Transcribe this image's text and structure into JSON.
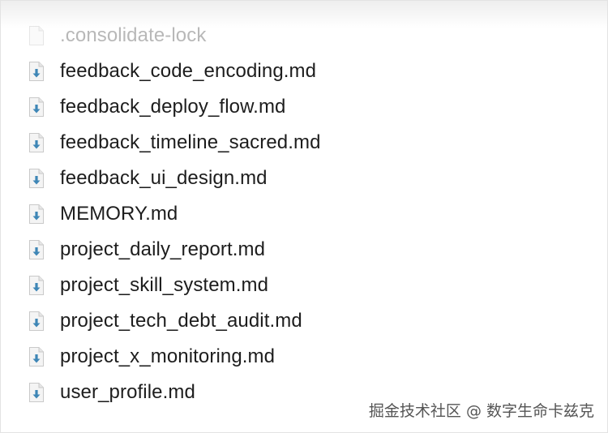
{
  "files": [
    {
      "name": ".consolidate-lock",
      "icon": "generic-file-icon",
      "dimmed": true
    },
    {
      "name": "feedback_code_encoding.md",
      "icon": "markdown-file-icon",
      "dimmed": false
    },
    {
      "name": "feedback_deploy_flow.md",
      "icon": "markdown-file-icon",
      "dimmed": false
    },
    {
      "name": "feedback_timeline_sacred.md",
      "icon": "markdown-file-icon",
      "dimmed": false
    },
    {
      "name": "feedback_ui_design.md",
      "icon": "markdown-file-icon",
      "dimmed": false
    },
    {
      "name": "MEMORY.md",
      "icon": "markdown-file-icon",
      "dimmed": false
    },
    {
      "name": "project_daily_report.md",
      "icon": "markdown-file-icon",
      "dimmed": false
    },
    {
      "name": "project_skill_system.md",
      "icon": "markdown-file-icon",
      "dimmed": false
    },
    {
      "name": "project_tech_debt_audit.md",
      "icon": "markdown-file-icon",
      "dimmed": false
    },
    {
      "name": "project_x_monitoring.md",
      "icon": "markdown-file-icon",
      "dimmed": false
    },
    {
      "name": "user_profile.md",
      "icon": "markdown-file-icon",
      "dimmed": false
    }
  ],
  "watermark": "掘金技术社区 @ 数字生命卡兹克",
  "colors": {
    "text": "#1d1d1d",
    "dimmed_text": "#b8b8b8",
    "icon_arrow": "#3e86b6",
    "icon_page": "#f4f4f4"
  }
}
